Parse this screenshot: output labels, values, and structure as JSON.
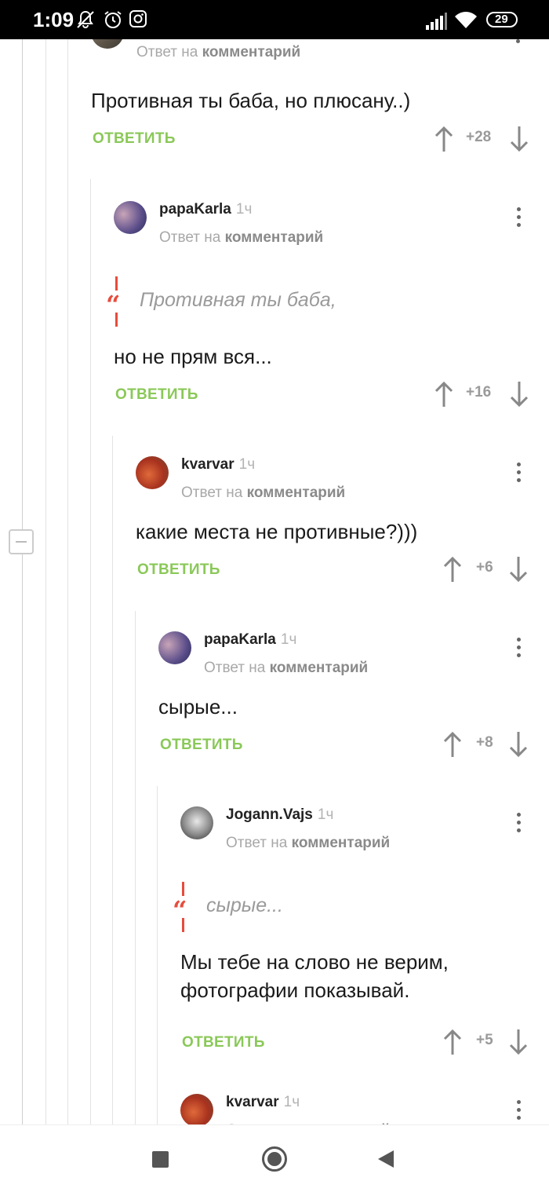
{
  "status_bar": {
    "time": "1:09",
    "battery": "29"
  },
  "reply_label": "ОТВЕТИТЬ",
  "reply_to_prefix": "Ответ на",
  "reply_to_target": "комментарий",
  "comments": [
    {
      "author": "",
      "time": "",
      "body": [
        "Противная ты баба, но плюсану..)"
      ],
      "quote": "",
      "votes": "+28"
    },
    {
      "author": "papaKarla",
      "time": "1ч",
      "quote": "Противная ты баба,",
      "body": [
        "но не прям вся..."
      ],
      "votes": "+16"
    },
    {
      "author": "kvarvar",
      "time": "1ч",
      "quote": "",
      "body": [
        "какие места не противные?)))"
      ],
      "votes": "+6"
    },
    {
      "author": "papaKarla",
      "time": "1ч",
      "quote": "",
      "body": [
        "сырые..."
      ],
      "votes": "+8"
    },
    {
      "author": "Jogann.Vajs",
      "time": "1ч",
      "quote": "сырые...",
      "body": [
        "Мы тебе на слово не верим,",
        "фотографии показывай."
      ],
      "votes": "+5"
    },
    {
      "author": "kvarvar",
      "time": "1ч",
      "quote": "",
      "body": [],
      "votes": ""
    }
  ],
  "colors": {
    "accent_green": "#8ac858",
    "quote_red": "#e74c3c"
  },
  "icons": [
    "mute-icon",
    "alarm-icon",
    "instagram-icon",
    "signal-icon",
    "wifi-icon",
    "battery-icon",
    "kebab-menu-icon",
    "arrow-up-icon",
    "arrow-down-icon",
    "quote-icon",
    "collapse-icon",
    "nav-recents-icon",
    "nav-home-icon",
    "nav-back-icon"
  ]
}
